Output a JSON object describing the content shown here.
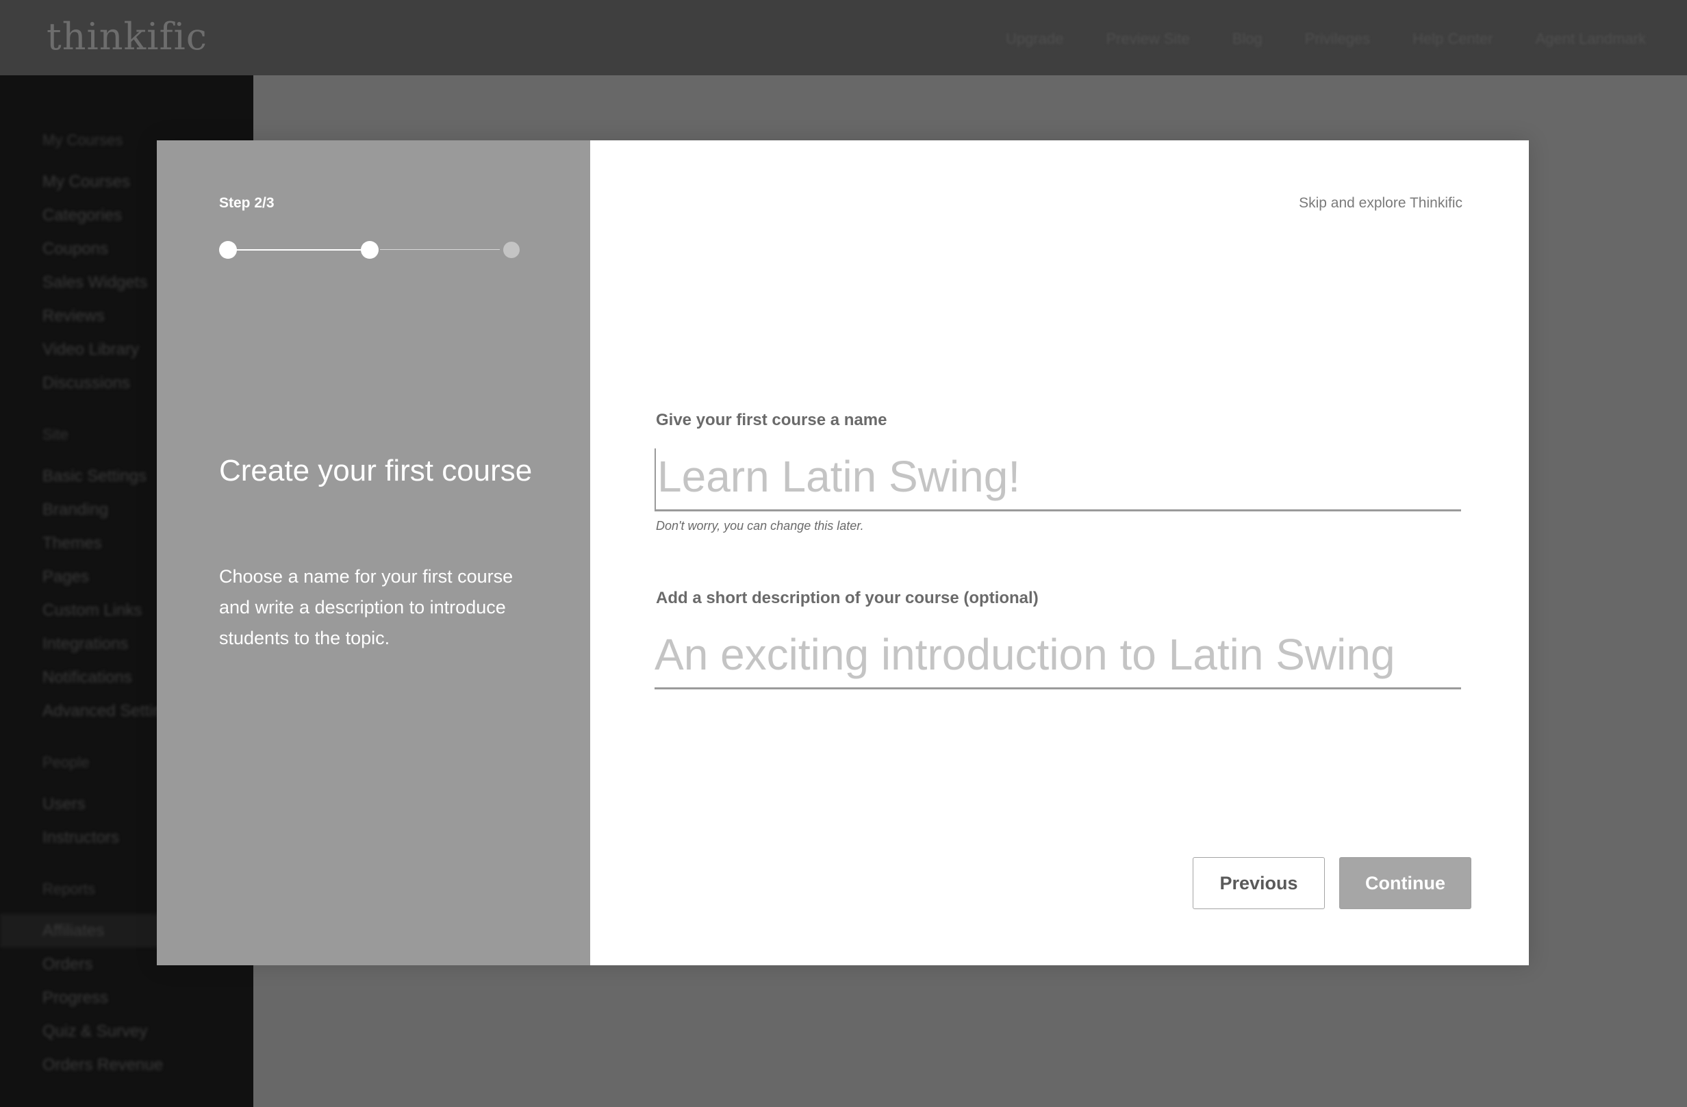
{
  "app": {
    "logo_text": "thinkific"
  },
  "topnav": {
    "items": [
      "Upgrade",
      "Preview Site",
      "Blog",
      "Privileges",
      "Help Center",
      "Agent Landmark"
    ]
  },
  "sidebar": {
    "groups": [
      {
        "heading": "My Courses",
        "items": [
          "My Courses",
          "Categories",
          "Coupons",
          "Sales Widgets",
          "Reviews",
          "Video Library",
          "Discussions"
        ]
      },
      {
        "heading": "Site",
        "items": [
          "Basic Settings",
          "Branding",
          "Themes",
          "Pages",
          "Custom Links",
          "Integrations",
          "Notifications",
          "Advanced Settings"
        ]
      },
      {
        "heading": "People",
        "items": [
          "Users",
          "Instructors"
        ]
      },
      {
        "heading": "Reports",
        "items": [
          "Affiliates",
          "Orders",
          "Progress",
          "Quiz & Survey",
          "Orders Revenue"
        ]
      }
    ]
  },
  "modal": {
    "step_label": "Step 2/3",
    "progress": {
      "current_step": 2,
      "total_steps": 3
    },
    "title": "Create your first course",
    "description": "Choose a name for your first course and write a description to introduce students to the topic.",
    "skip_link": "Skip and explore Thinkific",
    "course_name": {
      "label": "Give your first course a name",
      "placeholder": "Learn Latin Swing!",
      "value": "",
      "hint": "Don't worry, you can change this later."
    },
    "course_description": {
      "label": "Add a short description of your course (optional)",
      "placeholder": "An exciting introduction to Latin Swing",
      "value": ""
    },
    "buttons": {
      "previous": "Previous",
      "continue": "Continue"
    }
  },
  "colors": {
    "left_panel": "#9a9a9a",
    "backdrop": "#686868",
    "sidebar": "#111111",
    "topbar": "#3f3f3f",
    "continue_button": "#a6a6a6"
  }
}
